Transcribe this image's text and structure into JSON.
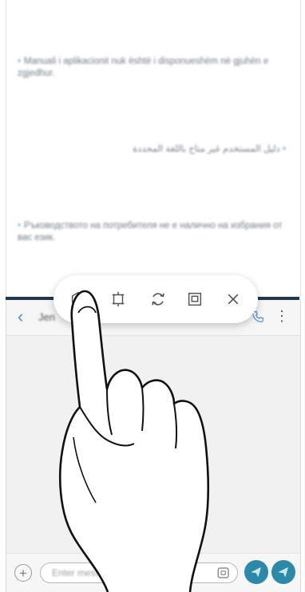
{
  "top_window": {
    "lines": [
      "Manuali i aplikacionit nuk është i disponueshëm në gjuhën e zgjedhur.",
      "دليل المستخدم غير متاح باللغة المحددة",
      "Ръководството на потребителя не е налично на избрания от вас език."
    ]
  },
  "toolbar": {
    "buttons": [
      {
        "name": "save-content-icon"
      },
      {
        "name": "adjust-window-icon"
      },
      {
        "name": "switch-windows-icon"
      },
      {
        "name": "maximize-window-icon"
      },
      {
        "name": "close-icon"
      }
    ]
  },
  "chat": {
    "contact_name": "Jen",
    "input_placeholder": "Enter message"
  },
  "colors": {
    "divider": "#21394a",
    "accent": "#4a90d9",
    "send_button": "#2c8aa8"
  }
}
